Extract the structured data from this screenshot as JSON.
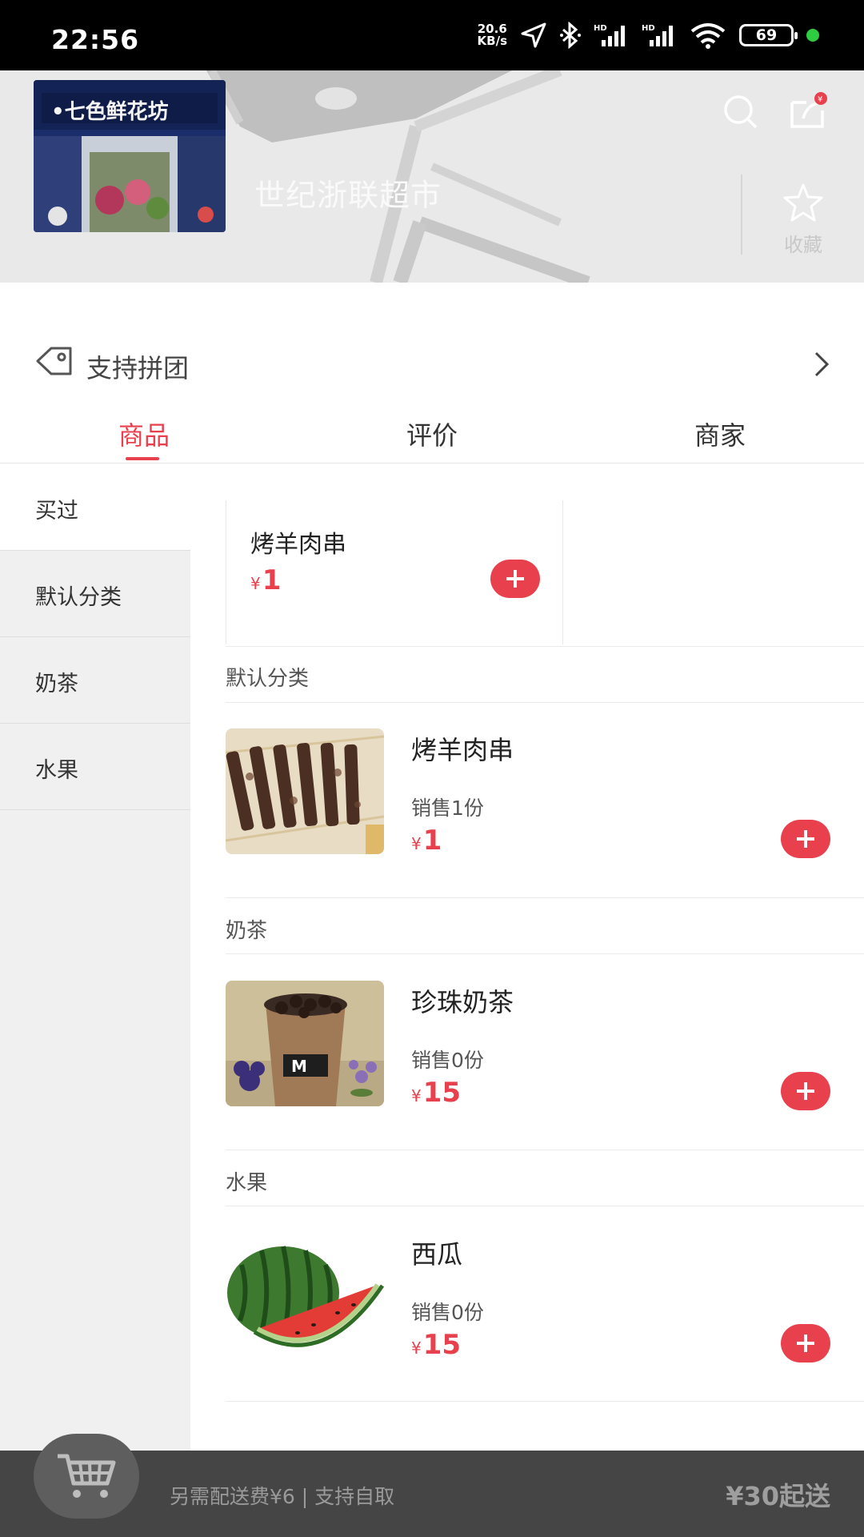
{
  "status_bar": {
    "time": "22:56",
    "net_speed_value": "20.6",
    "net_speed_unit": "KB/s",
    "battery": "69"
  },
  "header": {
    "shop_name": "世纪浙联超市",
    "favorite_label": "收藏",
    "share_badge": "¥"
  },
  "promo": {
    "text": "支持拼团"
  },
  "tabs": [
    {
      "label": "商品",
      "active": true
    },
    {
      "label": "评价",
      "active": false
    },
    {
      "label": "商家",
      "active": false
    }
  ],
  "categories": [
    {
      "label": "买过",
      "selected": true
    },
    {
      "label": "默认分类",
      "selected": false
    },
    {
      "label": "奶茶",
      "selected": false
    },
    {
      "label": "水果",
      "selected": false
    }
  ],
  "bought": {
    "name": "烤羊肉串",
    "currency": "¥",
    "price": "1"
  },
  "sections": [
    {
      "title": "默认分类",
      "product": {
        "name": "烤羊肉串",
        "sales": "销售1份",
        "currency": "¥",
        "price": "1",
        "image": "lamb-skewers"
      }
    },
    {
      "title": "奶茶",
      "product": {
        "name": "珍珠奶茶",
        "sales": "销售0份",
        "currency": "¥",
        "price": "15",
        "image": "bubble-tea"
      }
    },
    {
      "title": "水果",
      "product": {
        "name": "西瓜",
        "sales": "销售0份",
        "currency": "¥",
        "price": "15",
        "image": "watermelon"
      }
    }
  ],
  "cart_bar": {
    "delivery_text": "另需配送费¥6 | 支持自取",
    "min_order": "¥30起送"
  },
  "colors": {
    "accent": "#e8404d",
    "cart_bar": "#454545",
    "sidebar_bg": "#f0f0f0"
  }
}
